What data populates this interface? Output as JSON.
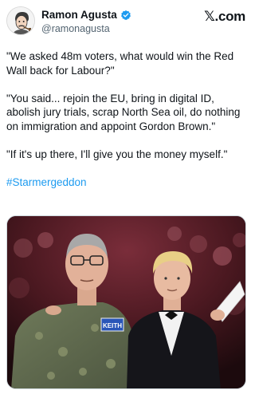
{
  "author": {
    "display_name": "Ramon Agusta",
    "handle": "@ramonagusta",
    "verified": true
  },
  "site": {
    "label": "𝕏.com"
  },
  "tweet": {
    "paragraphs": [
      "\"We asked 48m voters, what would win the Red Wall back for Labour?\"",
      "\"You said... rejoin the EU, bring in digital ID, abolish jury trials, scrap North Sea oil, do nothing on immigration and appoint Gordon Brown.\"",
      "\"If it's up there, I'll give you the money myself.\""
    ],
    "hashtag": "#Starmergeddon"
  },
  "media": {
    "name_badge": "KEITH"
  },
  "colors": {
    "link": "#1d9bf0",
    "verified_badge": "#1d9bf0",
    "secondary_text": "#536471"
  }
}
